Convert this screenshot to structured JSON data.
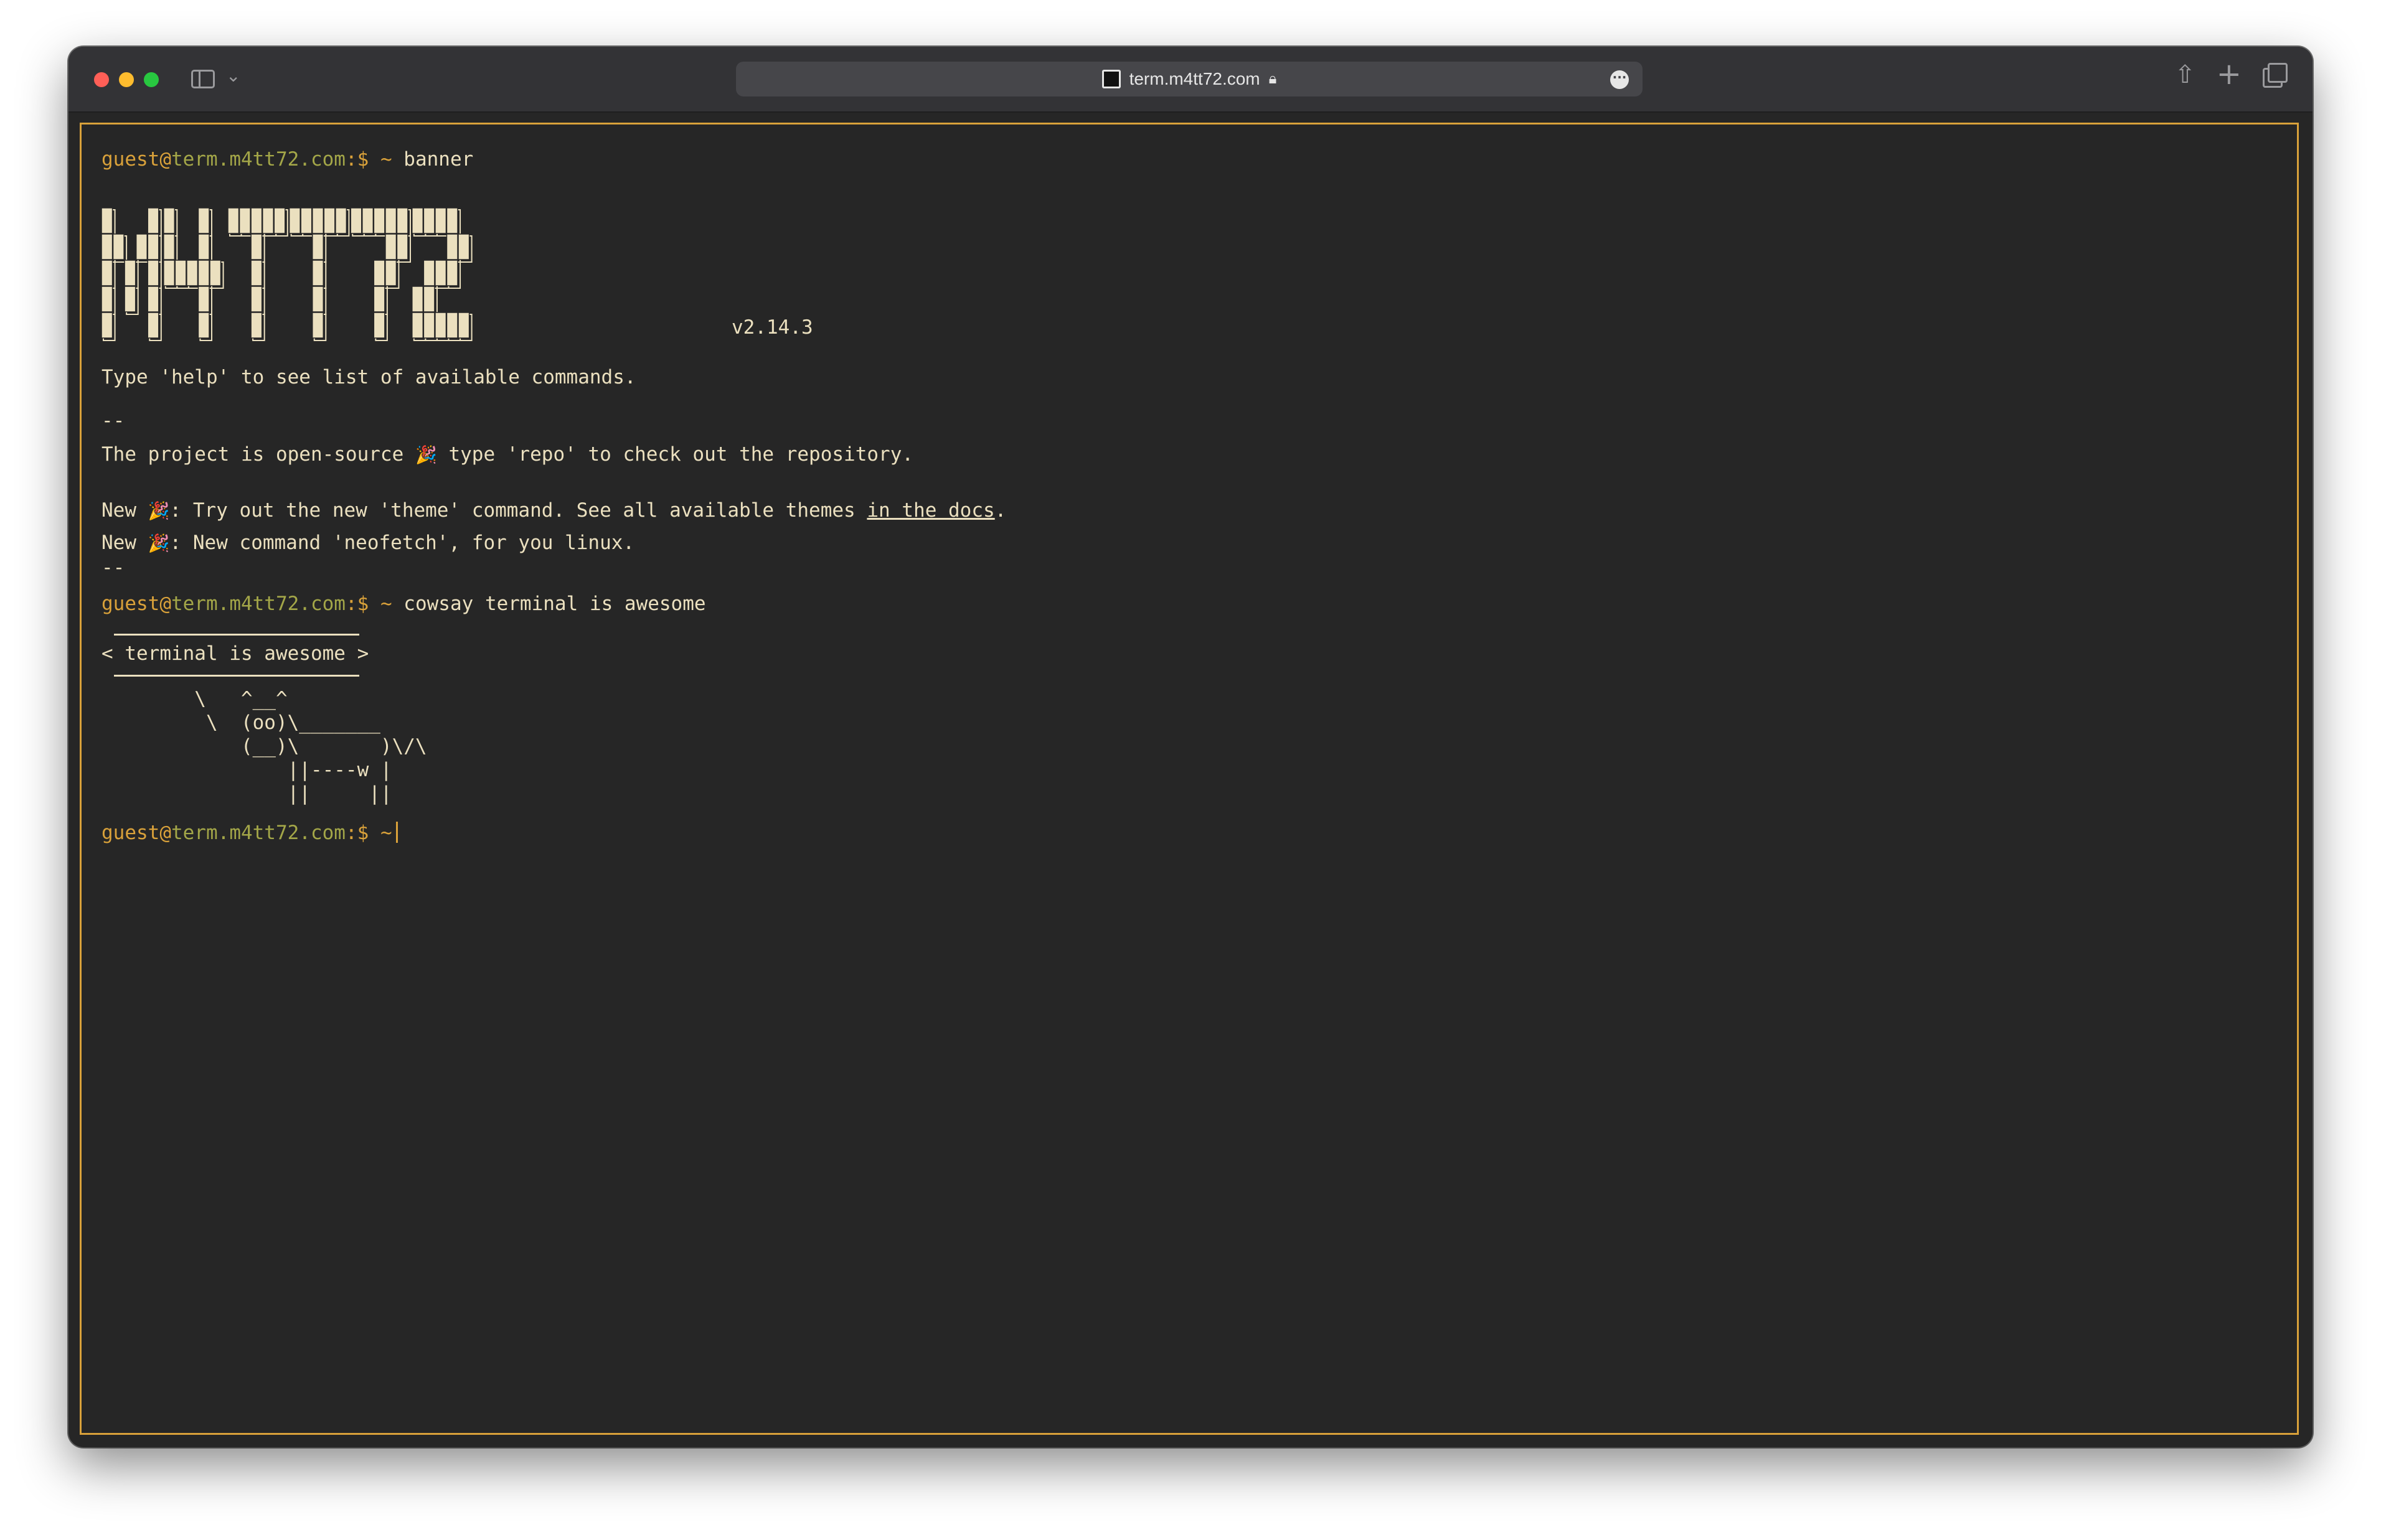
{
  "browser": {
    "url": "term.m4tt72.com",
    "icons": {
      "sidebar": "sidebar-icon",
      "chevron": "chevron-down-icon",
      "lock": "lock-icon",
      "more": "more-icon",
      "share": "share-icon",
      "new_tab": "plus-icon",
      "tabs": "tabs-overview-icon"
    }
  },
  "terminal": {
    "prompt": {
      "user": "guest",
      "at": "@",
      "host": "term.m4tt72.com",
      "suffix": ":$ ~"
    },
    "commands": [
      "banner",
      "cowsay terminal is awesome"
    ],
    "banner_text": "M4TT72",
    "version": "v2.14.3",
    "help_line": "Type 'help' to see list of available commands.",
    "separator": "--",
    "open_source_prefix": "The project is open-source",
    "open_source_suffix": "type 'repo' to check out the repository.",
    "new1_prefix": "New",
    "new1_text": ": Try out the new 'theme' command. See all available themes",
    "new1_link": "in the docs",
    "new1_end": ".",
    "new2_prefix": "New",
    "new2_text": ": New command 'neofetch', for you linux.",
    "emoji": "🎉",
    "cowsay": {
      "bubble": "< terminal is awesome >",
      "cow": [
        "        \\   ^__^",
        "         \\  (oo)\\_______",
        "            (__)\\       )\\/\\",
        "                ||----w |",
        "                ||     ||"
      ]
    }
  },
  "colors": {
    "accent": "#d9a13a",
    "host": "#a3a648",
    "text": "#ebe0bf",
    "background": "#262626",
    "banner_fill": "#ebe0bf"
  }
}
